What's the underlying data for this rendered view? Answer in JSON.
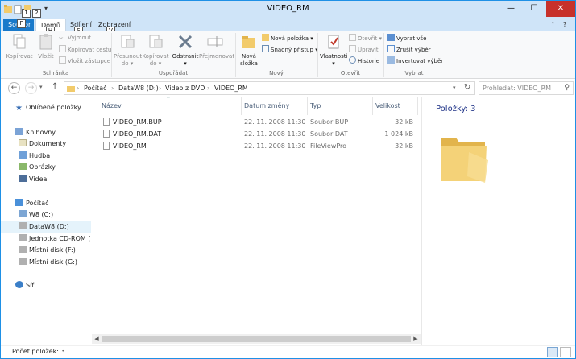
{
  "window": {
    "title": "VIDEO_RM",
    "keytips": [
      "1",
      "2",
      "F",
      "H",
      "S",
      "V"
    ],
    "minimize": "—",
    "maximize": "☐",
    "close": "✕"
  },
  "tabs": {
    "file": "Soubor",
    "home": "Domů",
    "share": "Sdílení",
    "view": "Zobrazení"
  },
  "ribbon": {
    "clipboard": {
      "label": "Schránka",
      "copy": "Kopírovat",
      "paste": "Vložit",
      "cut": "Vyjmout",
      "copy_path": "Kopírovat cestu",
      "paste_shortcut": "Vložit zástupce"
    },
    "organize": {
      "label": "Uspořádat",
      "move_to": "Přesunout",
      "copy_to": "Kopírovat",
      "to_suffix": "do",
      "delete": "Odstranit",
      "rename": "Přejmenovat"
    },
    "new": {
      "label": "Nový",
      "new_folder_line1": "Nová",
      "new_folder_line2": "složka",
      "new_item": "Nová položka",
      "easy_access": "Snadný přístup"
    },
    "open": {
      "label": "Otevřít",
      "properties": "Vlastnosti",
      "open": "Otevřít",
      "edit": "Upravit",
      "history": "Historie"
    },
    "select": {
      "label": "Vybrat",
      "select_all": "Vybrat vše",
      "select_none": "Zrušit výběr",
      "invert": "Invertovat výběr"
    }
  },
  "address": {
    "crumbs": [
      "Počítač",
      "DataW8 (D:)",
      "Video z DVD",
      "VIDEO_RM"
    ],
    "search_placeholder": "Prohledat: VIDEO_RM"
  },
  "nav": {
    "favorites": "Oblíbené položky",
    "libraries": "Knihovny",
    "documents": "Dokumenty",
    "music": "Hudba",
    "pictures": "Obrázky",
    "videos": "Videa",
    "computer": "Počítač",
    "drive_c": "W8 (C:)",
    "drive_d": "DataW8 (D:)",
    "drive_e": "Jednotka CD-ROM (E",
    "drive_f": "Místní disk (F:)",
    "drive_g": "Místní disk (G:)",
    "network": "Síť"
  },
  "columns": {
    "name": "Název",
    "date": "Datum změny",
    "type": "Typ",
    "size": "Velikost"
  },
  "files": [
    {
      "name": "VIDEO_RM.BUP",
      "date": "22. 11. 2008 11:30",
      "type": "Soubor BUP",
      "size": "32 kB"
    },
    {
      "name": "VIDEO_RM.DAT",
      "date": "22. 11. 2008 11:30",
      "type": "Soubor DAT",
      "size": "1 024 kB"
    },
    {
      "name": "VIDEO_RM",
      "date": "22. 11. 2008 11:30",
      "type": "FileViewPro",
      "size": "32 kB"
    }
  ],
  "preview": {
    "title": "Položky: 3"
  },
  "status": {
    "count": "Počet položek: 3"
  },
  "colors": {
    "accent": "#1979ca",
    "title_bg": "#cfe4f8",
    "close_red": "#c7312b",
    "folder_yellow": "#f2cb6b"
  }
}
